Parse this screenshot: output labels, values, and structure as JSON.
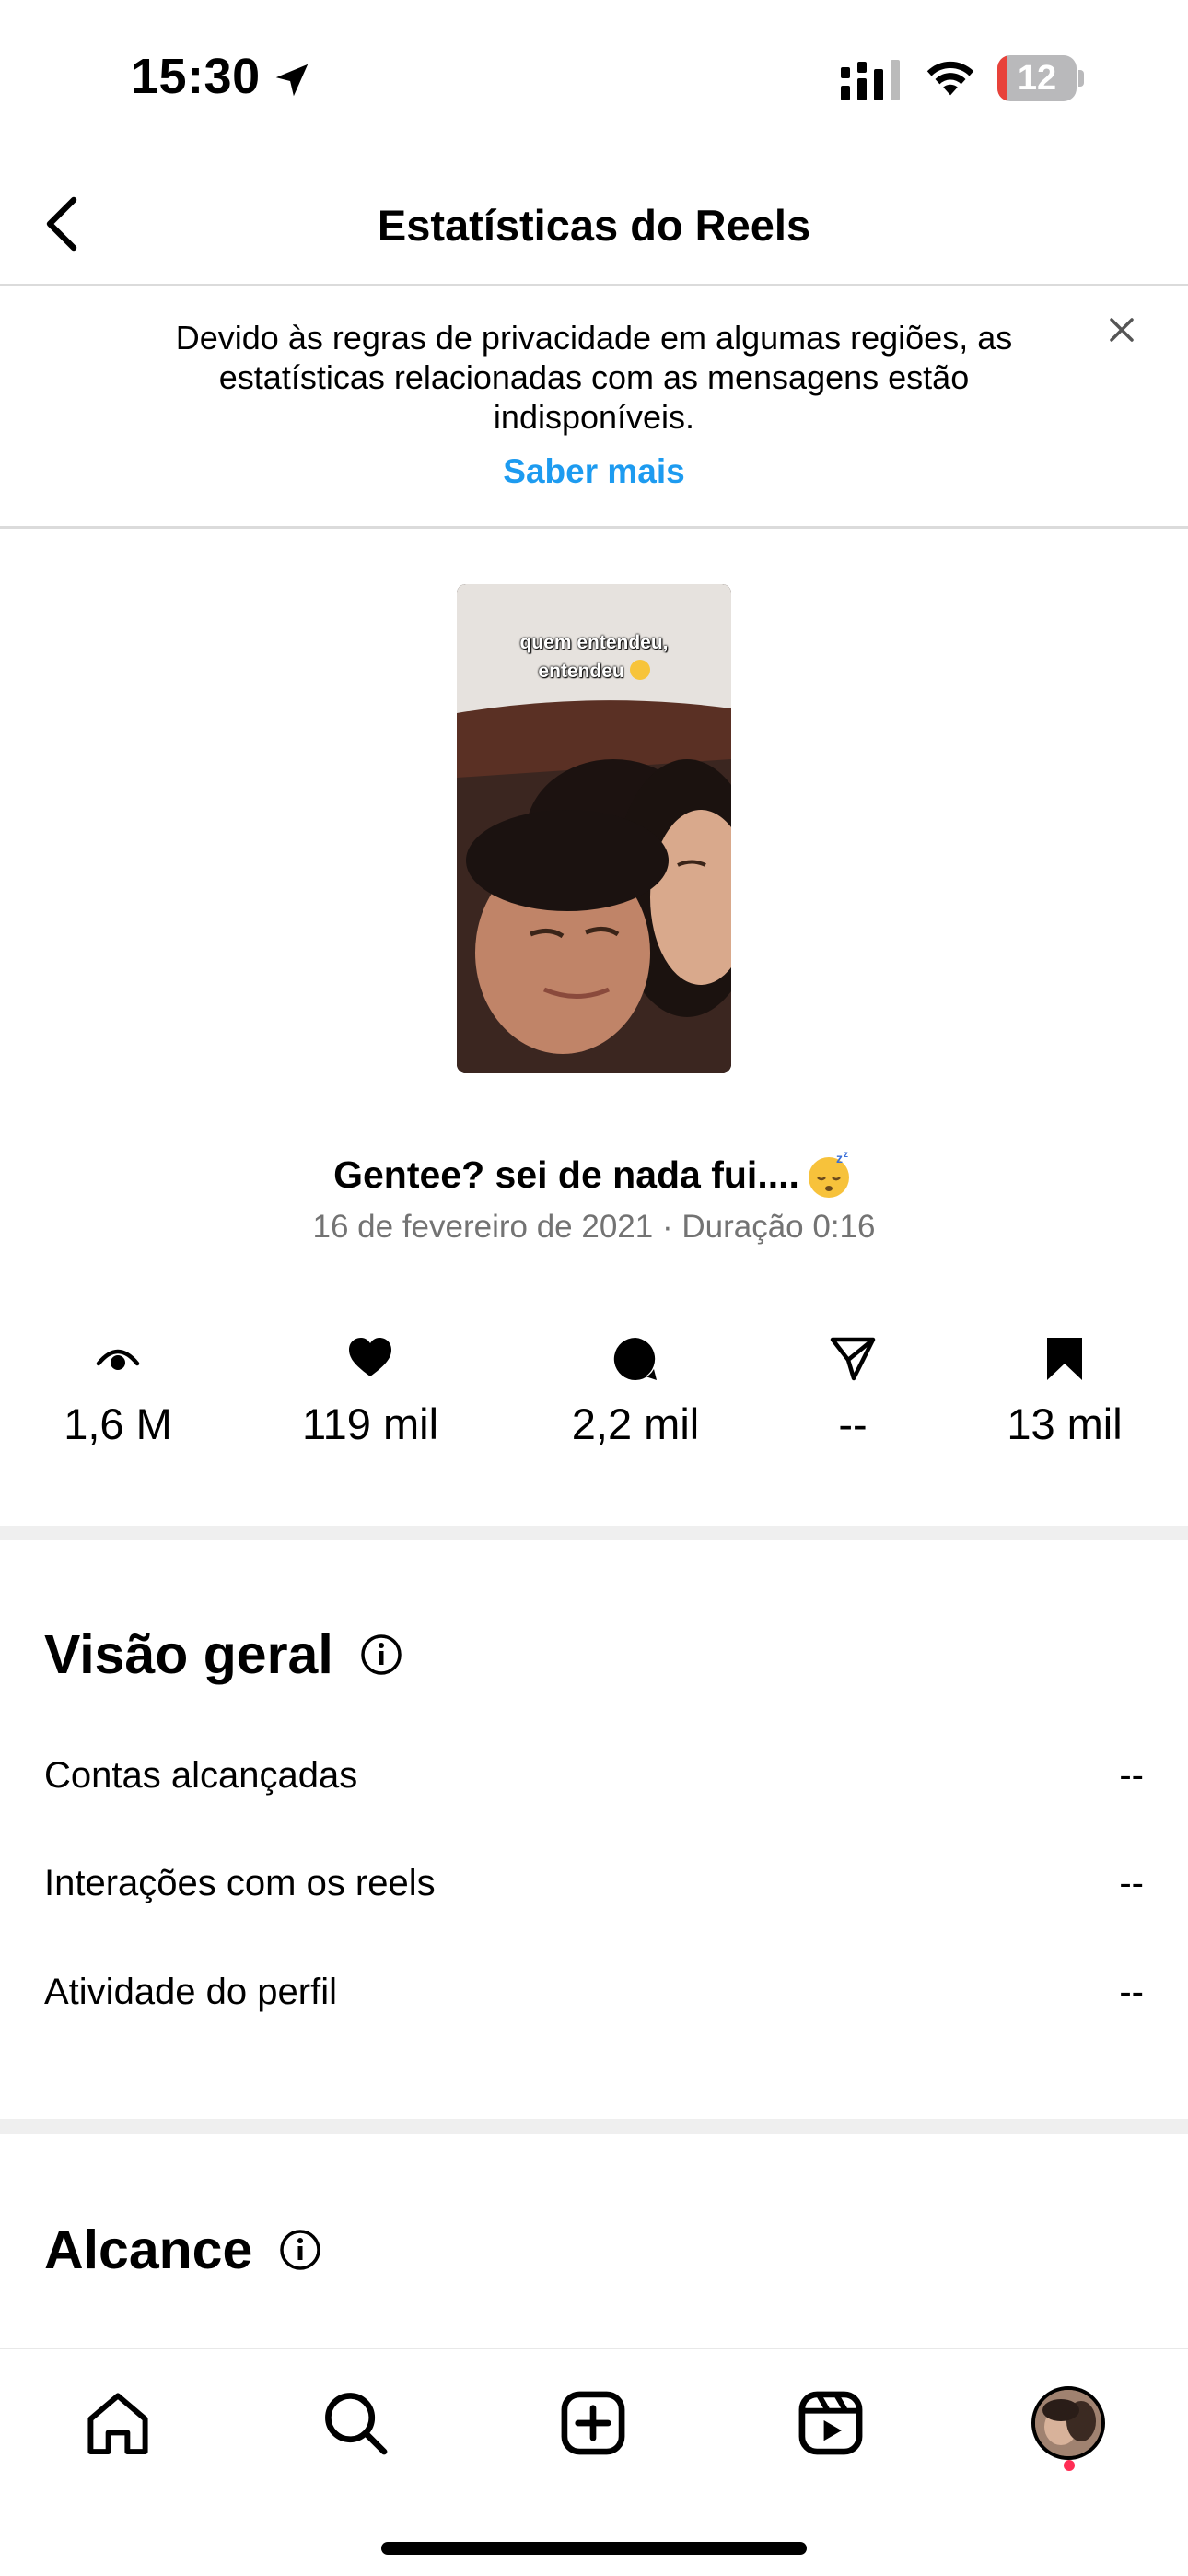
{
  "status_bar": {
    "time": "15:30",
    "battery_level": "12",
    "battery_fraction": 0.12,
    "icons": [
      "location-arrow-icon",
      "cellular-signal-icon",
      "wifi-icon",
      "battery-icon"
    ]
  },
  "nav": {
    "title": "Estatísticas do Reels",
    "back_icon": "chevron-left-icon"
  },
  "notice": {
    "text": "Devido às regras de privacidade em algumas regiões, as estatísticas relacionadas com as mensagens estão indisponíveis.",
    "link": "Saber mais",
    "close_icon": "close-icon"
  },
  "reel": {
    "thumbnail_caption_line1": "quem entendeu,",
    "thumbnail_caption_line2": "entendeu",
    "title": "Gentee? sei de nada fui....",
    "meta": "16 de fevereiro de 2021 · Duração 0:16"
  },
  "metrics": [
    {
      "icon": "eye-play-icon",
      "value": "1,6 M"
    },
    {
      "icon": "heart-icon",
      "value": "119 mil"
    },
    {
      "icon": "comment-icon",
      "value": "2,2 mil"
    },
    {
      "icon": "send-icon",
      "value": "--"
    },
    {
      "icon": "bookmark-icon",
      "value": "13 mil"
    }
  ],
  "overview": {
    "title": "Visão geral",
    "rows": [
      {
        "label": "Contas alcançadas",
        "value": "--"
      },
      {
        "label": "Interações com os reels",
        "value": "--"
      },
      {
        "label": "Atividade do perfil",
        "value": "--"
      }
    ]
  },
  "reach": {
    "title": "Alcance"
  },
  "tab_bar": {
    "tabs": [
      "home-icon",
      "search-icon",
      "create-icon",
      "reels-icon",
      "profile-avatar"
    ]
  },
  "colors": {
    "link": "#1d9bf0",
    "meta_text": "#737373",
    "divider": "#dbdbdb",
    "section_gap": "#efefef",
    "notification_dot": "#ff2d55",
    "battery_low": "#e8423a"
  }
}
